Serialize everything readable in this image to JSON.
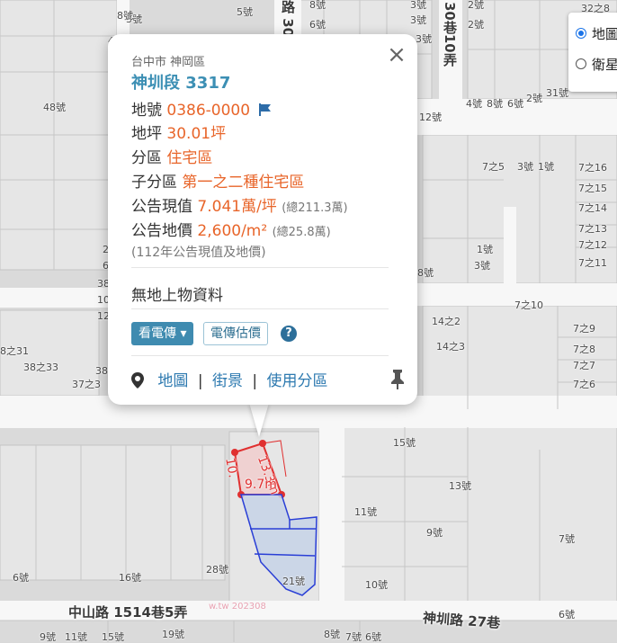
{
  "map": {
    "roads": [
      {
        "label": "中山路 1514巷5弄"
      },
      {
        "label": "神圳路 27巷"
      },
      {
        "label": "30巷10弄"
      },
      {
        "label": "路 30"
      }
    ],
    "numbers": [
      "5號",
      "8號",
      "6號",
      "3號",
      "3號",
      "2號",
      "3號",
      "2號",
      "2號",
      "31號",
      "32之8",
      "4號",
      "12號",
      "8號",
      "6號",
      "7之5",
      "3號",
      "1號",
      "7之16",
      "7之15",
      "7之14",
      "7之13",
      "7之12",
      "7之11",
      "1號",
      "3號",
      "8號",
      "7之10",
      "14之2",
      "7之9",
      "14之3",
      "7之8",
      "7之7",
      "7之6",
      "8之31",
      "38之33",
      "37之3",
      "38",
      "15號",
      "13號",
      "11號",
      "9號",
      "7號",
      "28號",
      "21號",
      "10號",
      "6號",
      "16號",
      "6號",
      "19號",
      "15號",
      "11號",
      "9號",
      "7號",
      "8號",
      "6號",
      "48號",
      "2",
      "6",
      "10",
      "12",
      "38",
      "3號",
      "4號",
      "8號"
    ],
    "measures": [
      "13.3m",
      "10.",
      "9.7m"
    ],
    "watermark": "w.tw 202308"
  },
  "layer_switch": {
    "options": [
      {
        "label": "地圖",
        "selected": true
      },
      {
        "label": "衛星",
        "selected": false
      }
    ]
  },
  "popup": {
    "city": "台中市 神岡區",
    "title": "神圳段 3317",
    "lot_label": "地號",
    "lot_value": "0386-0000",
    "area_label": "地坪",
    "area_value": "30.01坪",
    "zone_label": "分區",
    "zone_value": "住宅區",
    "subzone_label": "子分區",
    "subzone_value": "第一之二種住宅區",
    "current_value_label": "公告現值",
    "current_value": "7.041萬/坪",
    "current_total": "(總211.3萬)",
    "land_price_label": "公告地價",
    "land_price": "2,600/m²",
    "land_price_total": "(總25.8萬)",
    "note": "(112年公告現值及地價)",
    "no_building": "無地上物資料",
    "btn_view_transcript": "看電傳 ▾",
    "btn_estimate": "電傳估價",
    "help": "?",
    "link_map": "地圖",
    "link_street": "街景",
    "link_zoning": "使用分區",
    "sep": "|"
  },
  "colors": {
    "accent": "#3c8fb4",
    "value": "#e8652a",
    "parcel_red": "#e03030",
    "parcel_blue": "#2a3fd6"
  }
}
